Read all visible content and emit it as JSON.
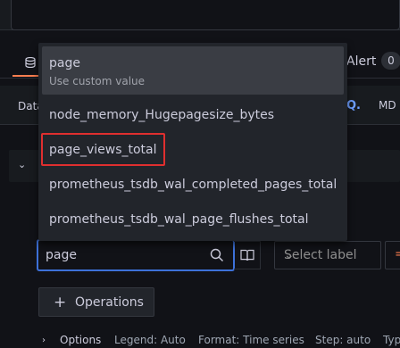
{
  "tabs": {
    "alert_label": "Alert",
    "alert_count": "0"
  },
  "options_bar": {
    "datasource_label": "Data",
    "query_inspector_label": "Q.",
    "md_label": "MD"
  },
  "metric_search": {
    "value": "page"
  },
  "label_filter": {
    "placeholder": "Select label",
    "operator": "="
  },
  "operations_button": {
    "label": "Operations",
    "plus": "+"
  },
  "options_row": {
    "title": "Options",
    "legend": "Legend: Auto",
    "format": "Format: Time series",
    "step": "Step: auto",
    "type": "Typ"
  },
  "dropdown": {
    "custom": {
      "name": "page",
      "sub": "Use custom value"
    },
    "items": [
      "node_memory_Hugepagesize_bytes",
      "page_views_total",
      "prometheus_tsdb_wal_completed_pages_total",
      "prometheus_tsdb_wal_page_flushes_total"
    ],
    "highlighted_item": "page_views_total"
  },
  "colors": {
    "accent": "#3d71d9",
    "tab_underline": "#ff7f50",
    "highlight": "#e02f2f",
    "link": "#6e9fff"
  }
}
